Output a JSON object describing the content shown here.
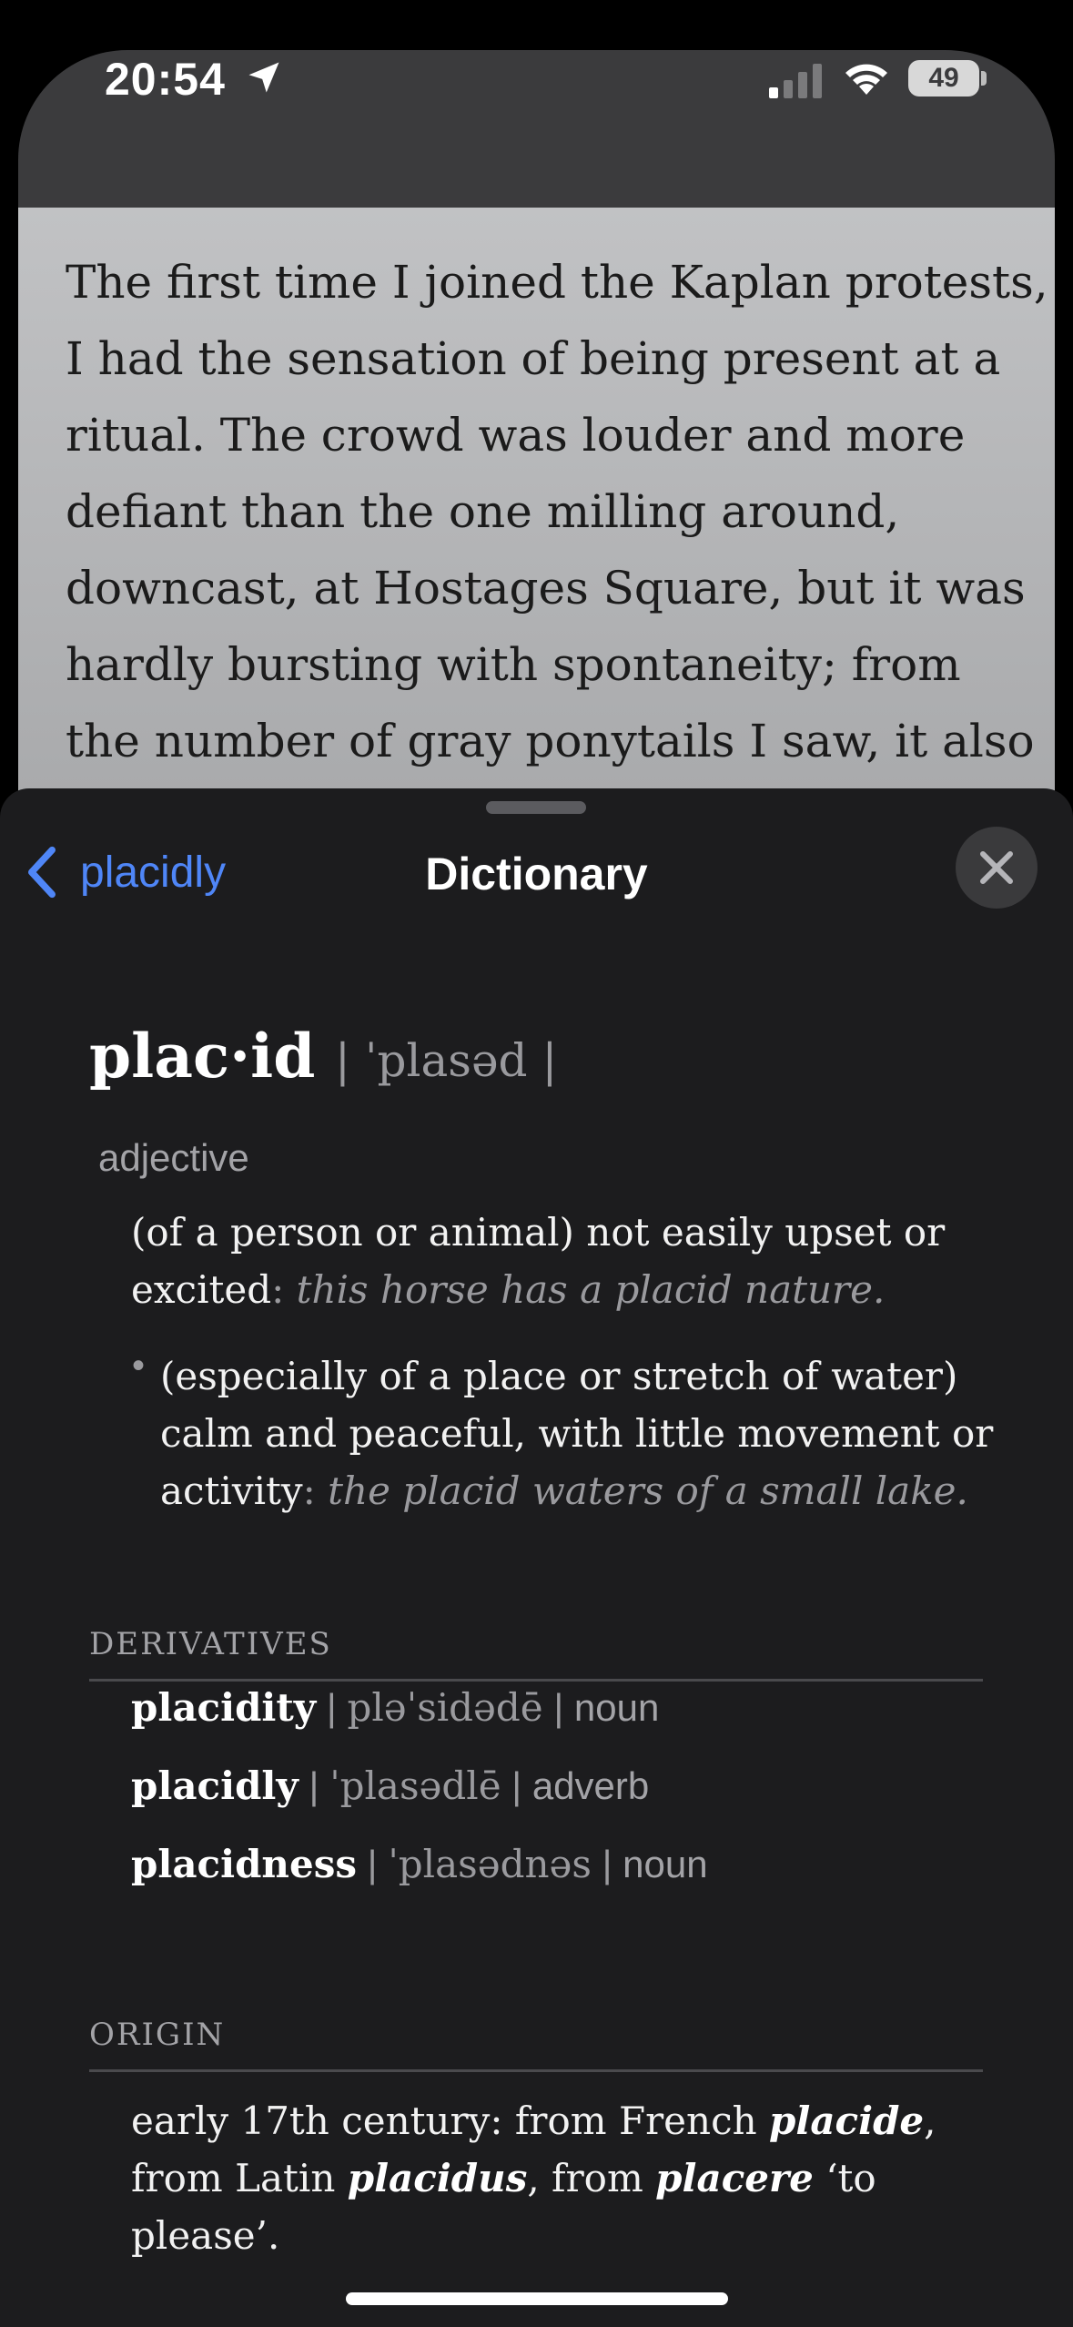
{
  "status_bar": {
    "time": "20:54",
    "battery": "49"
  },
  "article": {
    "text": "The first time I joined the Kaplan protests, I had the sensation of being present at a ritual. The crowd was louder and more defiant than the one milling around, downcast, at Hostages Square, but it was hardly bursting with spontaneity; from the number of gray ponytails I saw, it also"
  },
  "sheet": {
    "back_label": "placidly",
    "title": "Dictionary",
    "headword": "plac·id",
    "pronunciation": "| ˈplasəd |",
    "part_of_speech": "adjective",
    "def1_text": "(of a person or animal) not easily upset or excited",
    "def1_example": "this horse has a placid nature.",
    "def2_text": "(especially of a place or stretch of water) calm and peaceful, with little movement or activity",
    "def2_example": "the placid waters of a small lake.",
    "derivatives_heading": "DERIVATIVES",
    "derivatives": [
      {
        "word": "placidity",
        "pron": "pləˈsidədē",
        "pos": "noun"
      },
      {
        "word": "placidly",
        "pron": "ˈplasədlē",
        "pos": "adverb"
      },
      {
        "word": "placidness",
        "pron": "ˈplasədnəs",
        "pos": "noun"
      }
    ],
    "origin_heading": "ORIGIN",
    "origin": {
      "part1": "early 17th century: from French ",
      "w1": "placide",
      "part2": ", from Latin ",
      "w2": "placidus",
      "part3": ", from ",
      "w3": "placere",
      "part4": " ‘to please’."
    }
  },
  "colors": {
    "accent": "#4f86f7",
    "sheet_bg": "#1c1c1e"
  },
  "icons": [
    "location-arrow-icon",
    "cellular-signal-icon",
    "wifi-icon",
    "battery-icon",
    "chevron-left-icon",
    "close-icon"
  ]
}
